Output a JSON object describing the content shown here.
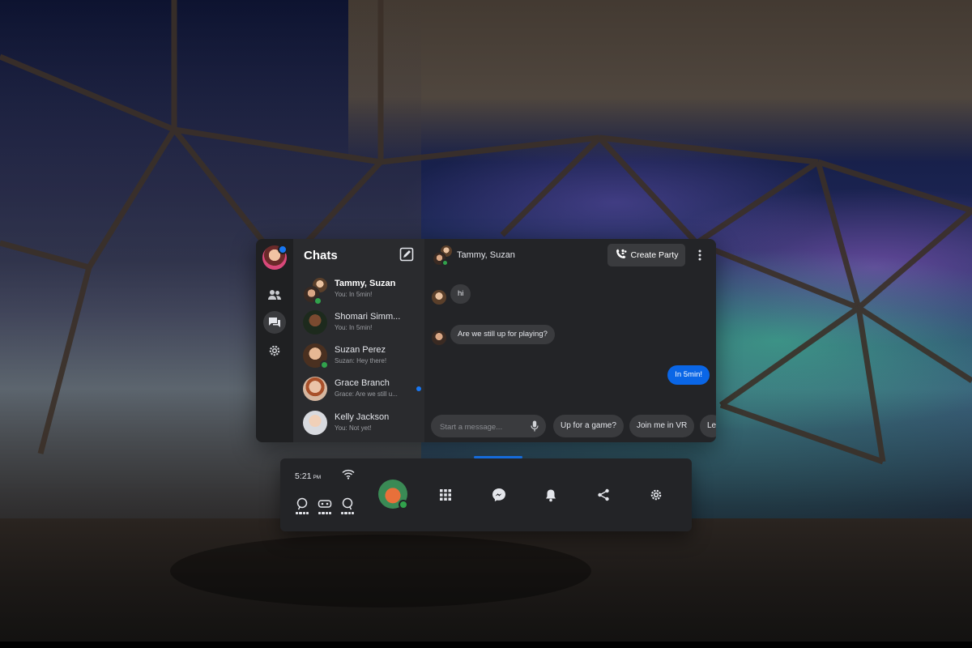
{
  "sidebar": {
    "icons": [
      "profile-avatar",
      "people-icon",
      "chat-icon",
      "gear-icon"
    ]
  },
  "chats": {
    "title": "Chats",
    "items": [
      {
        "name": "Tammy, Suzan",
        "preview": "You: In 5min!",
        "bold": true,
        "online": true,
        "unread": false
      },
      {
        "name": "Shomari Simm...",
        "preview": "You: In 5min!",
        "bold": false,
        "online": false,
        "unread": false
      },
      {
        "name": "Suzan Perez",
        "preview": "Suzan: Hey there!",
        "bold": false,
        "online": true,
        "unread": false
      },
      {
        "name": "Grace Branch",
        "preview": "Grace: Are we still u...",
        "bold": false,
        "online": false,
        "unread": true
      },
      {
        "name": "Kelly Jackson",
        "preview": "You: Not yet!",
        "bold": false,
        "online": false,
        "unread": false
      }
    ]
  },
  "conversation": {
    "title": "Tammy, Suzan",
    "create_party_label": "Create Party",
    "messages": [
      {
        "text": "hi",
        "from": "other"
      },
      {
        "text": "Are we still up for playing?",
        "from": "other"
      },
      {
        "text": "In 5min!",
        "from": "me"
      }
    ],
    "composer_placeholder": "Start a message...",
    "quick_replies": [
      "Up for a game?",
      "Join me in VR",
      "Le"
    ]
  },
  "menubar": {
    "time": "5:21",
    "ampm": "PM",
    "icons": [
      "wifi-icon",
      "left-controller-icon",
      "headset-icon",
      "right-controller-icon",
      "apps-icon",
      "messenger-icon",
      "bell-icon",
      "share-icon",
      "gear-icon"
    ]
  },
  "colors": {
    "accent": "#1877f2",
    "online": "#31a24c",
    "panel": "#2a2b2e"
  }
}
